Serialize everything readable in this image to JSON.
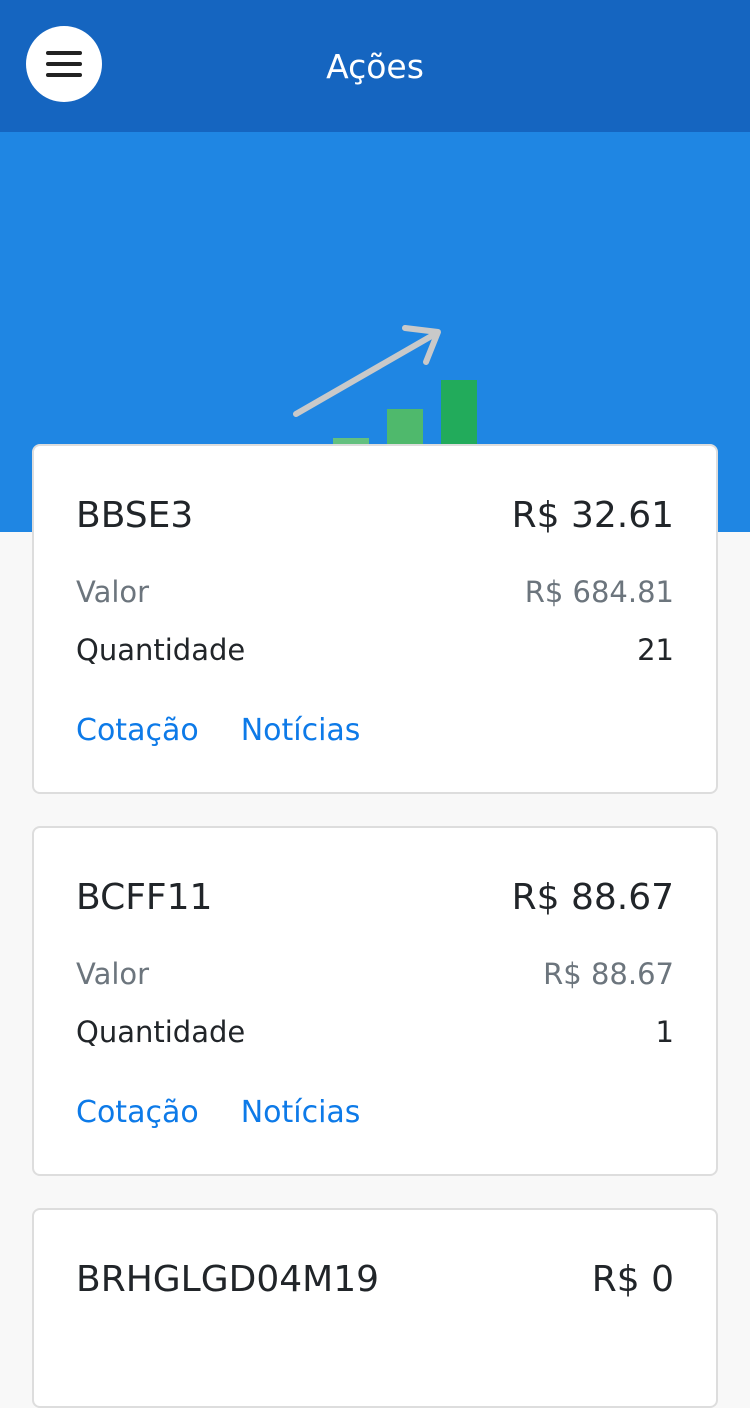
{
  "header": {
    "title": "Ações"
  },
  "stocks": [
    {
      "ticker": "BBSE3",
      "price": "R$ 32.61",
      "valor_label": "Valor",
      "valor": "R$ 684.81",
      "qty_label": "Quantidade",
      "qty": "21",
      "link_quote": "Cotação",
      "link_news": "Notícias"
    },
    {
      "ticker": "BCFF11",
      "price": "R$ 88.67",
      "valor_label": "Valor",
      "valor": "R$ 88.67",
      "qty_label": "Quantidade",
      "qty": "1",
      "link_quote": "Cotação",
      "link_news": "Notícias"
    },
    {
      "ticker": "BRHGLGD04M19",
      "price": "R$ 0"
    }
  ],
  "colors": {
    "header": "#1565c0",
    "hero": "#1f86e3",
    "link": "#0d7ae8",
    "bars": [
      "#7fd19b",
      "#63c07f",
      "#4fb96c",
      "#22ab5b"
    ]
  },
  "icons": {
    "menu": "hamburger-icon",
    "hero": "growth-chart-illustration"
  }
}
